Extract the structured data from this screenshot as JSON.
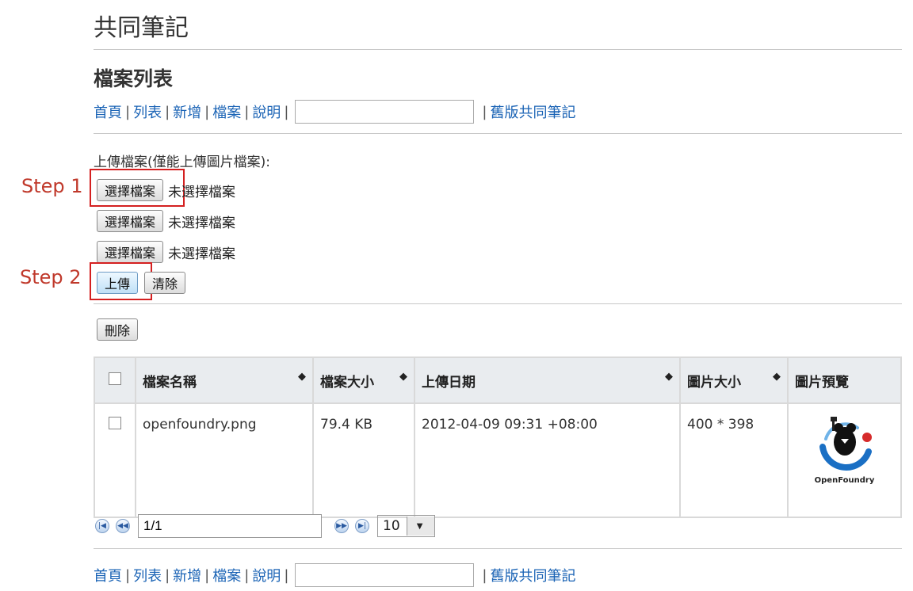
{
  "site_title": "共同筆記",
  "page_heading": "檔案列表",
  "nav": {
    "items": [
      "首頁",
      "列表",
      "新增",
      "檔案",
      "說明"
    ],
    "search_value": "",
    "old_version_link": "舊版共同筆記"
  },
  "upload": {
    "label": "上傳檔案(僅能上傳圖片檔案):",
    "choose_label": "選擇檔案",
    "no_file_text": "未選擇檔案",
    "upload_button": "上傳",
    "clear_button": "清除"
  },
  "annotations": {
    "step1": "Step 1",
    "step2": "Step 2",
    "box_color": "#d42020"
  },
  "delete_button": "刪除",
  "table": {
    "headers": [
      "檔案名稱",
      "檔案大小",
      "上傳日期",
      "圖片大小",
      "圖片預覽"
    ],
    "rows": [
      {
        "name": "openfoundry.png",
        "size": "79.4 KB",
        "date": "2012-04-09 09:31 +08:00",
        "dimensions": "400 * 398",
        "preview_caption": "OpenFoundry"
      }
    ]
  },
  "pager": {
    "page_value": "1/1",
    "page_size": "10"
  },
  "colors": {
    "link": "#1a63b5",
    "header_bg": "#e9ecef"
  }
}
